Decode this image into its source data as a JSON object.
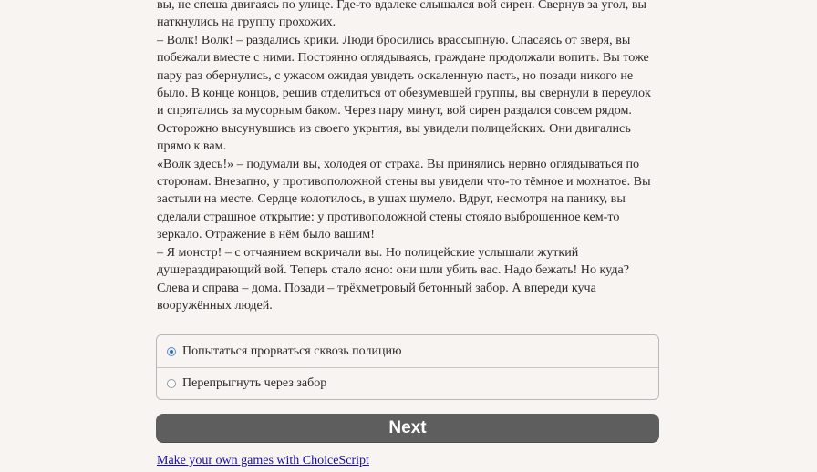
{
  "story": {
    "lines": [
      "вы, не спеша двигаясь по улице. Где-то вдалеке слышался вой сирен. Свернув за угол, вы",
      "наткнулись на группу прохожих.",
      "– Волк! Волк! – раздались крики. Люди бросились врассыпную. Спасаясь от зверя, вы",
      "побежали вместе с ними. Постоянно оглядываясь, граждане продолжали вопить. Вы тоже",
      "пару раз обернулись, с ужасом ожидая увидеть оскаленную пасть, но позади никого не",
      "было. В конце концов, решив отделиться от обезумевшей группы, вы свернули в переулок",
      "и спрятались за мусорным баком. Через пару минут, вой сирен раздался совсем рядом.",
      "Осторожно высунувшись из своего укрытия, вы увидели полицейских. Они двигались",
      "прямо к вам.",
      "«Волк здесь!» – подумали вы, холодея от страха. Вы принялись нервно оглядываться по",
      "сторонам. Внезапно, у противоположной стены вы увидели что-то тёмное и мохнатое. Вы",
      "застыли на месте. Сердце колотилось, в ушах шумело. Вдруг, несмотря на панику, вы",
      "сделали страшное открытие: у противоположной стены стояло выброшенное кем-то",
      "зеркало. Отражение в нём было вашим!",
      "– Я монстр! – с отчаянием вскричали вы. Но полицейские услышали жуткий",
      "душераздирающий вой. Теперь стало ясно: они шли убить вас. Надо бежать! Но куда?",
      "Слева и справа – дома. Позади – трёхметровый бетонный забор. А впереди куча",
      "вооружённых людей."
    ]
  },
  "choices": [
    {
      "label": "Попытаться прорваться сквозь полицию",
      "selected": true
    },
    {
      "label": "Перепрыгнуть через забор",
      "selected": false
    }
  ],
  "next_button": {
    "label": "Next"
  },
  "footer": {
    "link_text": "Make your own games with ChoiceScript"
  }
}
